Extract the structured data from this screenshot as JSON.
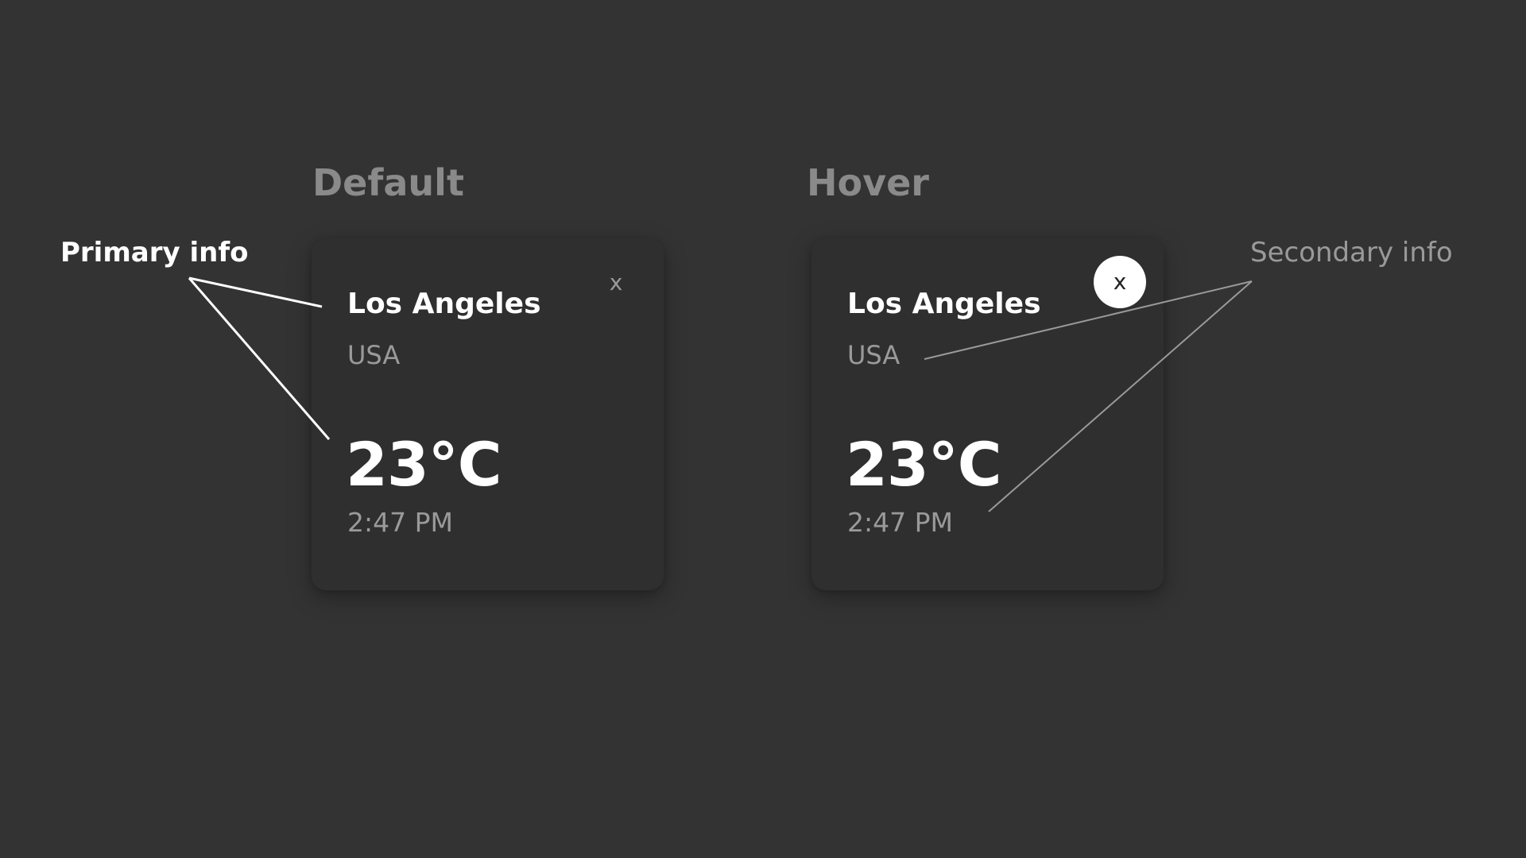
{
  "headings": {
    "default": "Default",
    "hover": "Hover"
  },
  "callouts": {
    "primary": "Primary info",
    "secondary": "Secondary info"
  },
  "cards": {
    "default": {
      "city": "Los Angeles",
      "country": "USA",
      "temperature": "23°C",
      "time": "2:47 PM",
      "close": "x"
    },
    "hover": {
      "city": "Los Angeles",
      "country": "USA",
      "temperature": "23°C",
      "time": "2:47 PM",
      "close": "x"
    }
  },
  "colors": {
    "background": "#333333",
    "card": "#2f2f2f",
    "primary_text": "#ffffff",
    "secondary_text": "#9a9a9a",
    "hover_close_bg": "#ffffff"
  }
}
